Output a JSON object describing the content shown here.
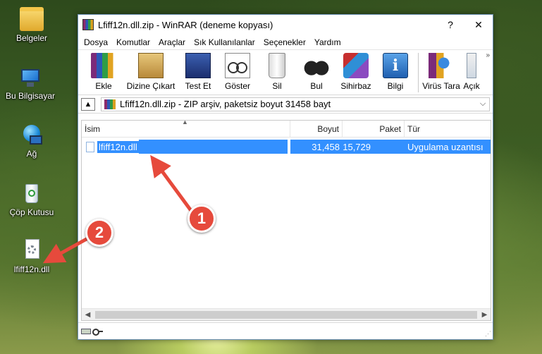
{
  "desktop": {
    "icons": [
      {
        "label": "Belgeler",
        "icon": "folder-icon"
      },
      {
        "label": "Bu Bilgisayar",
        "icon": "computer-icon"
      },
      {
        "label": "Ağ",
        "icon": "network-icon"
      },
      {
        "label": "Çöp Kutusu",
        "icon": "recycle-bin-icon"
      },
      {
        "label": "lfiff12n.dll",
        "icon": "dll-file-icon"
      }
    ]
  },
  "window": {
    "title": "Lfiff12n.dll.zip - WinRAR (deneme kopyası)",
    "help_label": "?",
    "close_label": "✕",
    "menu": [
      "Dosya",
      "Komutlar",
      "Araçlar",
      "Sık Kullanılanlar",
      "Seçenekler",
      "Yardım"
    ],
    "toolbar": [
      {
        "label": "Ekle",
        "icon": "add-icon"
      },
      {
        "label": "Dizine Çıkart",
        "icon": "extract-to-icon"
      },
      {
        "label": "Test Et",
        "icon": "test-icon"
      },
      {
        "label": "Göster",
        "icon": "view-icon"
      },
      {
        "label": "Sil",
        "icon": "delete-icon"
      },
      {
        "label": "Bul",
        "icon": "find-icon"
      },
      {
        "label": "Sihirbaz",
        "icon": "wizard-icon"
      },
      {
        "label": "Bilgi",
        "icon": "info-icon"
      },
      {
        "label": "Virüs Tara",
        "icon": "virus-scan-icon"
      },
      {
        "label": "Açık",
        "icon": "open-icon"
      }
    ],
    "toolbar_more": "»",
    "address": "Lfiff12n.dll.zip - ZIP arşiv, paketsiz boyut 31458 bayt",
    "columns": {
      "name": "İsim",
      "size": "Boyut",
      "packed": "Paket",
      "type": "Tür"
    },
    "files": [
      {
        "name": "lfiff12n.dll",
        "size": "31,458",
        "packed": "15,729",
        "type": "Uygulama uzantısı"
      }
    ]
  },
  "annotations": {
    "badge1": "1",
    "badge2": "2",
    "color": "#e64a3c"
  }
}
